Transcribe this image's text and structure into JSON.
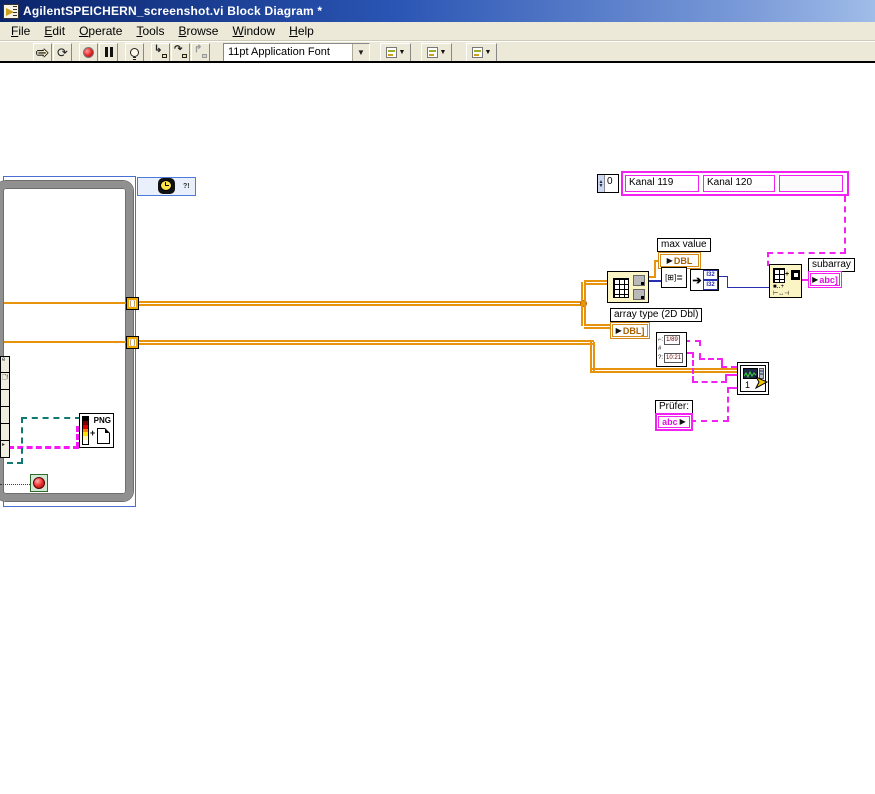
{
  "window": {
    "title": "AgilentSPEICHERN_screenshot.vi Block Diagram *"
  },
  "menu": {
    "items": [
      {
        "label": "File"
      },
      {
        "label": "Edit"
      },
      {
        "label": "Operate"
      },
      {
        "label": "Tools"
      },
      {
        "label": "Browse"
      },
      {
        "label": "Window"
      },
      {
        "label": "Help"
      }
    ]
  },
  "toolbar": {
    "font_selector": "11pt Application Font"
  },
  "diagram": {
    "wait_node": {
      "badge": "?!"
    },
    "channel_array": {
      "index": "0",
      "elements": [
        "Kanal 119",
        "Kanal 120",
        ""
      ]
    },
    "max_value": {
      "label": "max value",
      "type": "DBL"
    },
    "array_type": {
      "label": "array type (2D Dbl)",
      "type": "DBL]"
    },
    "i32_node": {
      "top": "I32",
      "bottom": "I32"
    },
    "datetime_node": {
      "r1_prefix": "⌐:",
      "date": "1/89",
      "r2": "#",
      "r3_prefix": "?:",
      "time": "10:21"
    },
    "subarray": {
      "label": "subarray",
      "type": "abc]"
    },
    "write_node": {
      "count": "1"
    },
    "pruefer": {
      "label": "Prüfer:",
      "type": "abc"
    },
    "png_node": {
      "text": "PNG",
      "plus": "+"
    }
  },
  "colors": {
    "titlebar_left": "#0a246a",
    "titlebar_right": "#a0bce8",
    "chrome_bg": "#ece9d8",
    "wire_dbl": "#e8930c",
    "wire_i32": "#2830b0",
    "wire_string": "#f322f3",
    "wire_path": "#0e7a72",
    "loop_border": "#909090",
    "selection": "#4a6fd0",
    "node_bg": "#fbf4c4"
  }
}
